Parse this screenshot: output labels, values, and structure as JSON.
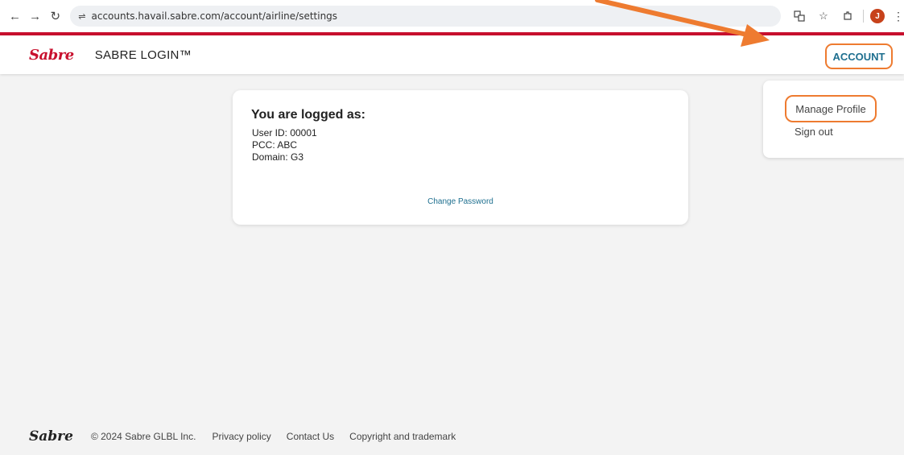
{
  "browser": {
    "url": "accounts.havail.sabre.com/account/airline/settings",
    "profile_initial": "J"
  },
  "header": {
    "logo": "Sabre",
    "title": "SABRE LOGIN™",
    "account_label": "ACCOUNT"
  },
  "dropdown": {
    "items": [
      {
        "label": "Manage Profile"
      },
      {
        "label": "Sign out"
      }
    ]
  },
  "card": {
    "heading": "You are logged as:",
    "user_id": "User ID: 00001",
    "pcc": "PCC: ABC",
    "domain": "Domain: G3",
    "change_password": "Change Password"
  },
  "footer": {
    "logo": "Sabre",
    "copyright": "© 2024 Sabre GLBL Inc.",
    "links": [
      {
        "label": "Privacy policy"
      },
      {
        "label": "Contact Us"
      },
      {
        "label": "Copyright and trademark"
      }
    ]
  },
  "colors": {
    "brand_red": "#c8102e",
    "accent_teal": "#1e6f8f",
    "highlight_orange": "#ee7b30"
  }
}
